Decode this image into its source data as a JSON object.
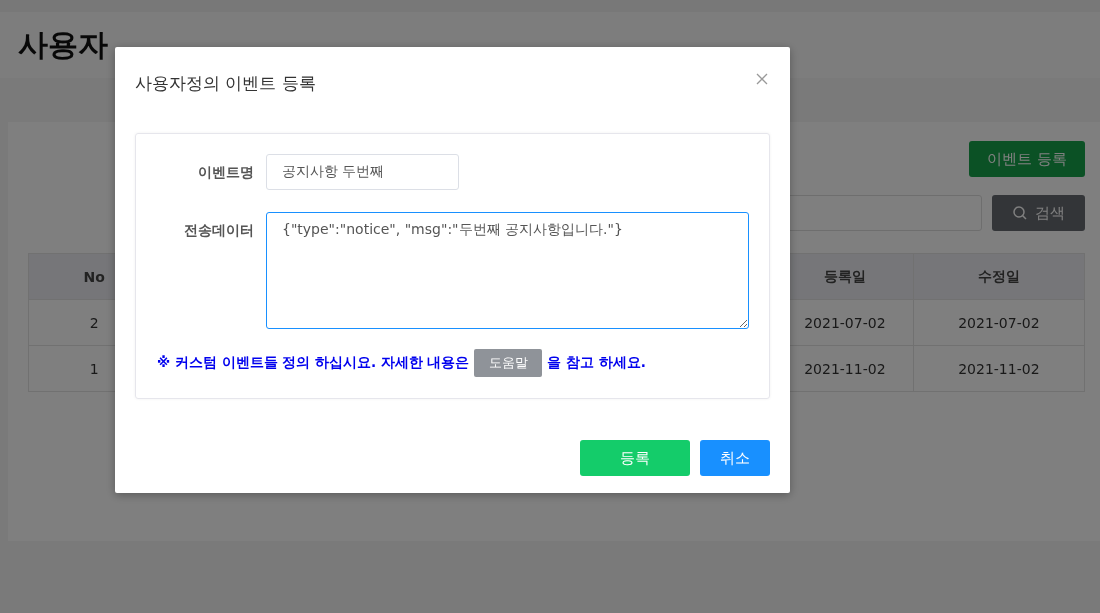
{
  "page": {
    "title": "사용자",
    "register_button": "이벤트 등록",
    "search_button": "검색"
  },
  "table": {
    "columns": [
      "No",
      "등록일",
      "수정일"
    ],
    "rows": [
      {
        "no": "2",
        "registered": "2021-07-02",
        "modified": "2021-07-02"
      },
      {
        "no": "1",
        "registered": "2021-11-02",
        "modified": "2021-11-02"
      }
    ]
  },
  "dialog": {
    "title": "사용자정의 이벤트 등록",
    "fields": [
      {
        "label": "이벤트명",
        "kind": "input",
        "value": "공지사항 두번째",
        "focused": false
      },
      {
        "label": "전송데이터",
        "kind": "textarea",
        "value": "{\"type\":\"notice\", \"msg\":\"두번째 공지사항입니다.\"}",
        "focused": true
      }
    ],
    "note": {
      "before": "※ 커스텀 이벤트들 정의 하십시요. 자세한 내용은",
      "help_button": "도움말",
      "after": "을 참고 하세요."
    },
    "buttons": [
      {
        "label": "등록",
        "kind": "primary"
      },
      {
        "label": "취소",
        "kind": "cancel"
      }
    ]
  }
}
